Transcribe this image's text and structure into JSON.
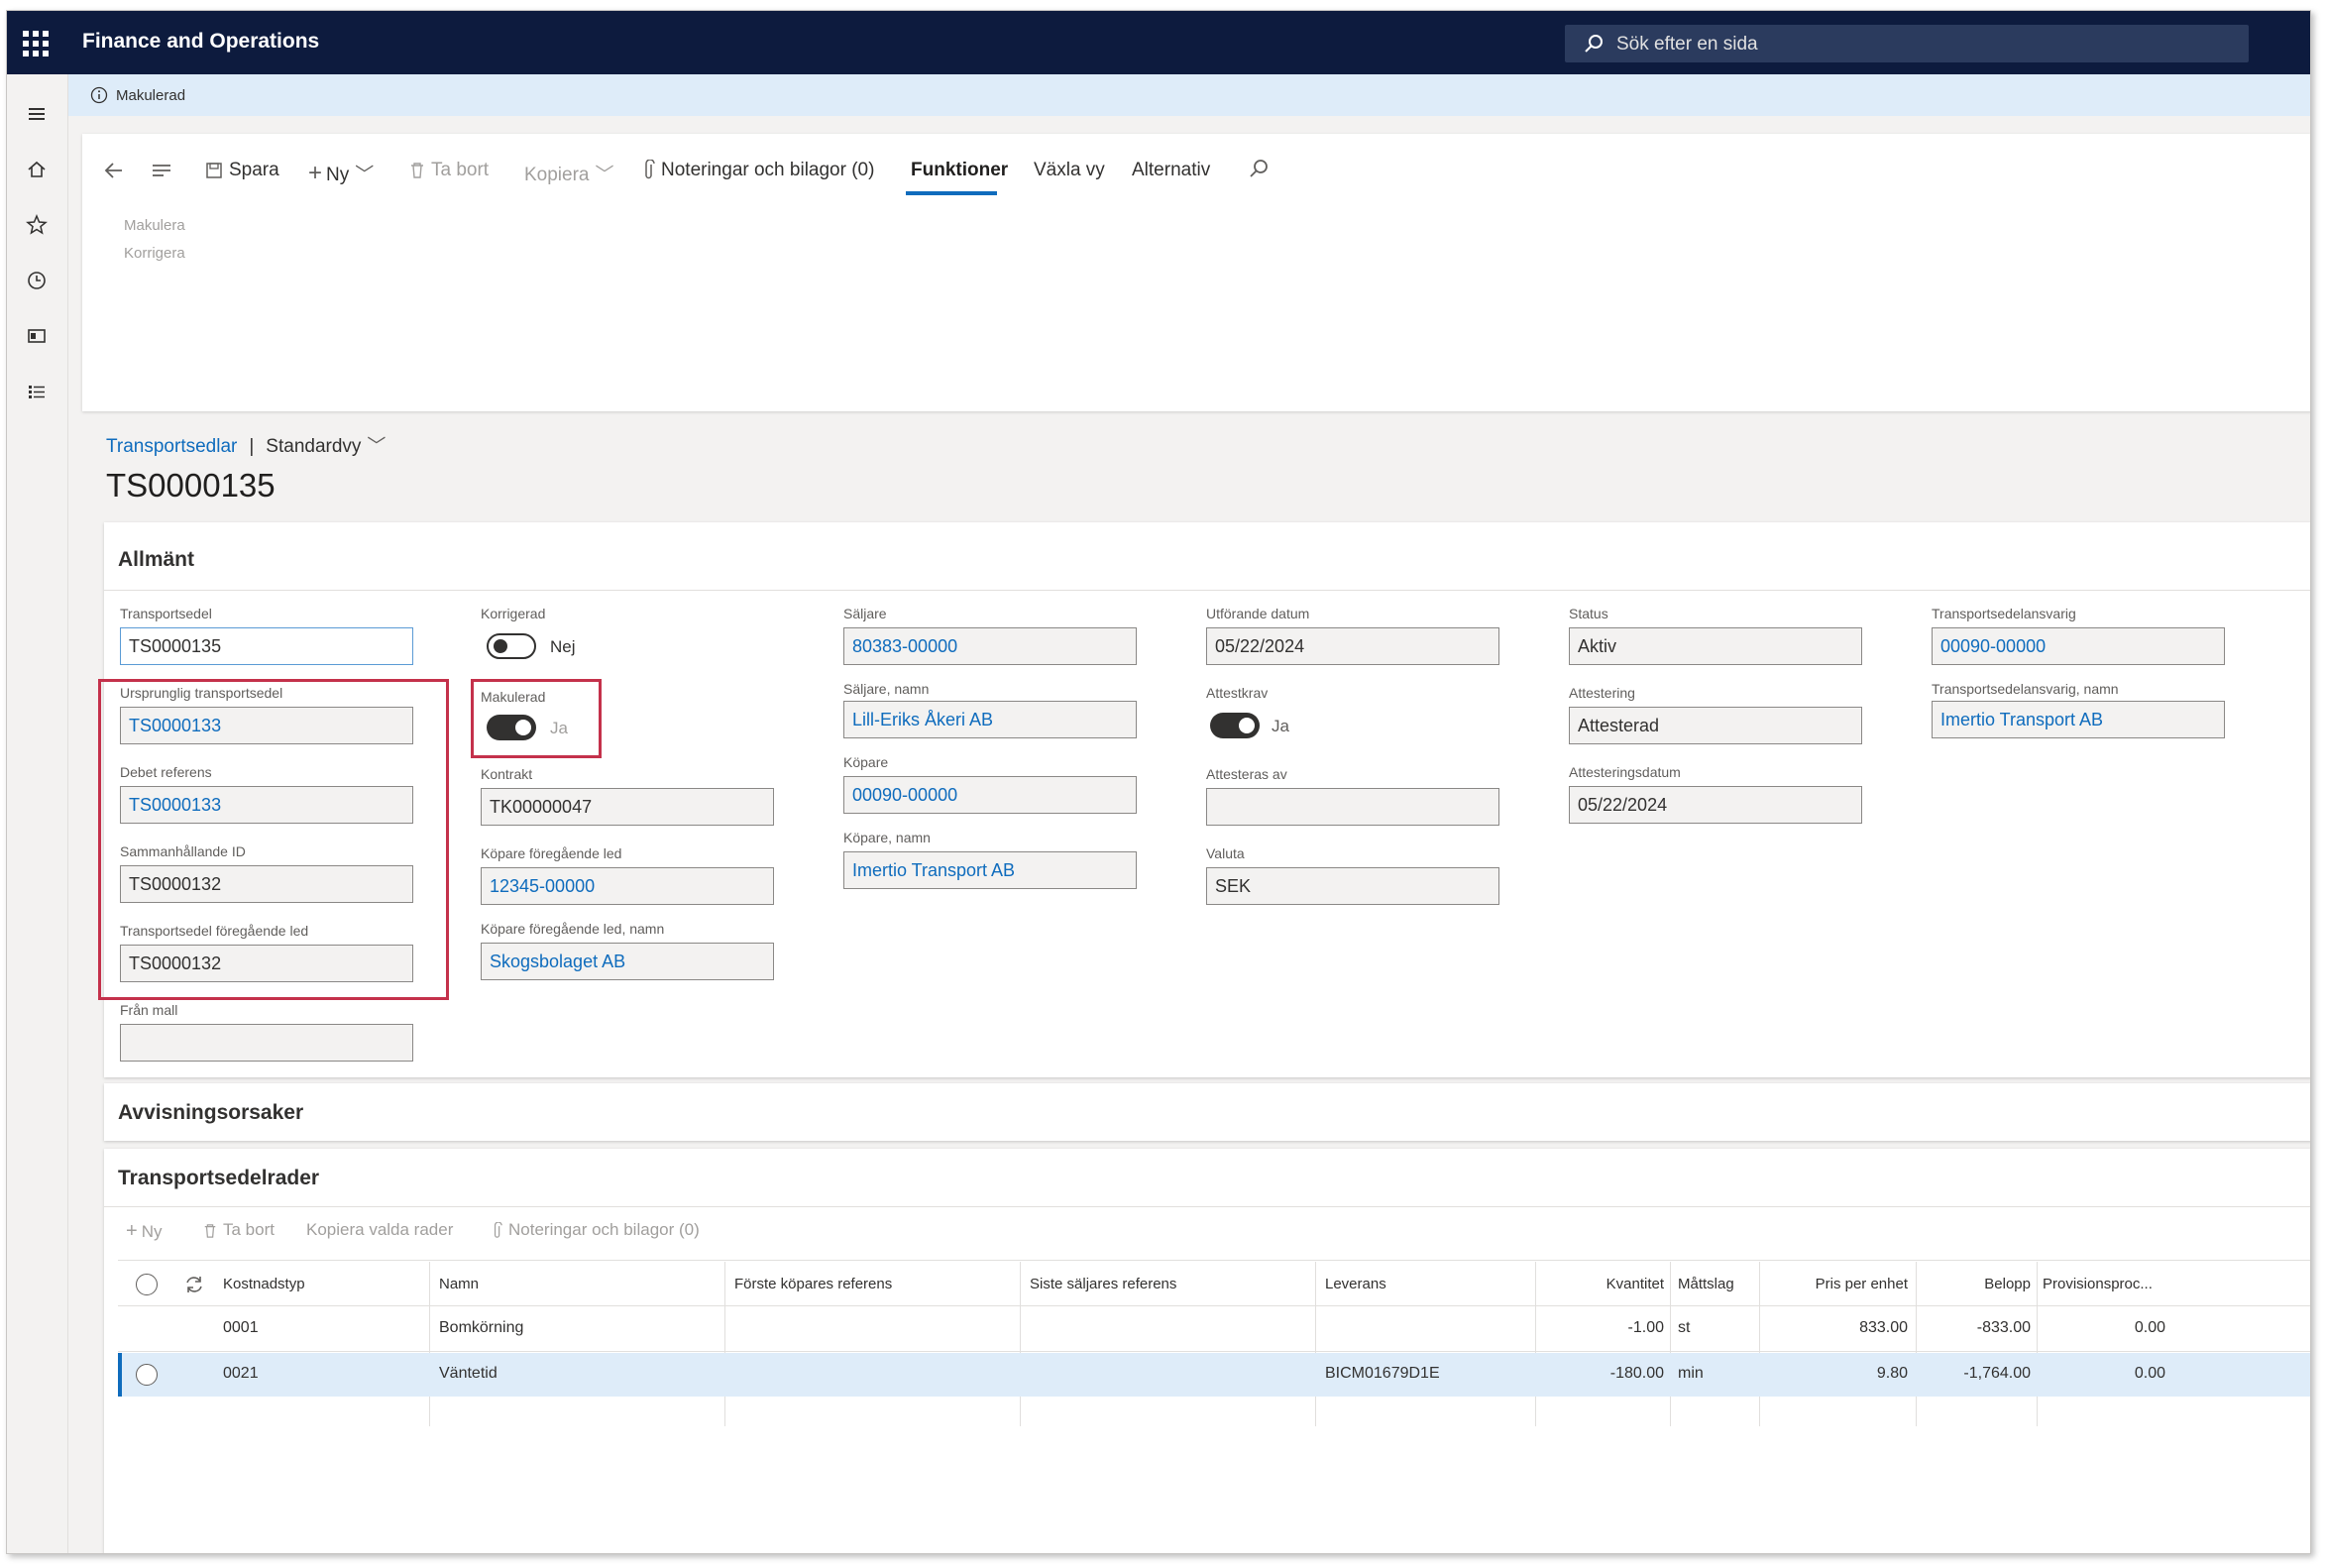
{
  "header": {
    "app_title": "Finance and Operations",
    "search_placeholder": "Sök efter en sida"
  },
  "info_bar": {
    "text": "Makulerad"
  },
  "action_pane": {
    "save": "Spara",
    "new": "Ny",
    "delete": "Ta bort",
    "copy": "Kopiera",
    "notes": "Noteringar och bilagor (0)",
    "functions": "Funktioner",
    "switch_view": "Växla vy",
    "options": "Alternativ",
    "sub_items": [
      "Makulera",
      "Korrigera"
    ]
  },
  "breadcrumb": {
    "link": "Transportsedlar",
    "separator": "|",
    "view": "Standardvy"
  },
  "page_title": "TS0000135",
  "general": {
    "title": "Allmänt",
    "col1": [
      {
        "label": "Transportsedel",
        "value": "TS0000135"
      },
      {
        "label": "Ursprunglig transportsedel",
        "value": "TS0000133"
      },
      {
        "label": "Debet referens",
        "value": "TS0000133"
      },
      {
        "label": "Sammanhållande ID",
        "value": "TS0000132"
      },
      {
        "label": "Transportsedel föregående led",
        "value": "TS0000132"
      },
      {
        "label": "Från mall",
        "value": ""
      }
    ],
    "col2": {
      "corrected_label": "Korrigerad",
      "corrected_text": "Nej",
      "voided_label": "Makulerad",
      "voided_text": "Ja",
      "contract_label": "Kontrakt",
      "contract_value": "TK00000047",
      "prev_buyer_label": "Köpare föregående led",
      "prev_buyer_value": "12345-00000",
      "prev_buyer_name_label": "Köpare föregående led, namn",
      "prev_buyer_name_value": "Skogsbolaget AB"
    },
    "col3": [
      {
        "label": "Säljare",
        "value": "80383-00000"
      },
      {
        "label": "Säljare, namn",
        "value": "Lill-Eriks Åkeri AB"
      },
      {
        "label": "Köpare",
        "value": "00090-00000"
      },
      {
        "label": "Köpare, namn",
        "value": "Imertio Transport AB"
      }
    ],
    "col4": {
      "exec_date_label": "Utförande datum",
      "exec_date_value": "05/22/2024",
      "attest_req_label": "Attestkrav",
      "attest_req_text": "Ja",
      "attested_by_label": "Attesteras av",
      "attested_by_value": "",
      "currency_label": "Valuta",
      "currency_value": "SEK"
    },
    "col5": [
      {
        "label": "Status",
        "value": "Aktiv"
      },
      {
        "label": "Attestering",
        "value": "Attesterad"
      },
      {
        "label": "Attesteringsdatum",
        "value": "05/22/2024"
      }
    ],
    "col6": [
      {
        "label": "Transportsedelansvarig",
        "value": "00090-00000"
      },
      {
        "label": "Transportsedelansvarig, namn",
        "value": "Imertio Transport AB"
      }
    ]
  },
  "rejections": {
    "title": "Avvisningsorsaker"
  },
  "lines": {
    "title": "Transportsedelrader",
    "toolbar": {
      "new": "Ny",
      "delete": "Ta bort",
      "copy_rows": "Kopiera valda rader",
      "notes": "Noteringar och bilagor (0)"
    },
    "columns": [
      "Kostnadstyp",
      "Namn",
      "Förste köpares referens",
      "Siste säljares referens",
      "Leverans",
      "Kvantitet",
      "Måttslag",
      "Pris per enhet",
      "Belopp",
      "Provisionsproc..."
    ],
    "rows": [
      {
        "cost_type": "0001",
        "name": "Bomkörning",
        "first_ref": "",
        "last_ref": "",
        "delivery": "",
        "qty": "-1.00",
        "unit": "st",
        "price": "833.00",
        "amount": "-833.00",
        "commission": "0.00"
      },
      {
        "cost_type": "0021",
        "name": "Väntetid",
        "first_ref": "",
        "last_ref": "",
        "delivery": "BICM01679D1E",
        "qty": "-180.00",
        "unit": "min",
        "price": "9.80",
        "amount": "-1,764.00",
        "commission": "0.00"
      }
    ]
  }
}
